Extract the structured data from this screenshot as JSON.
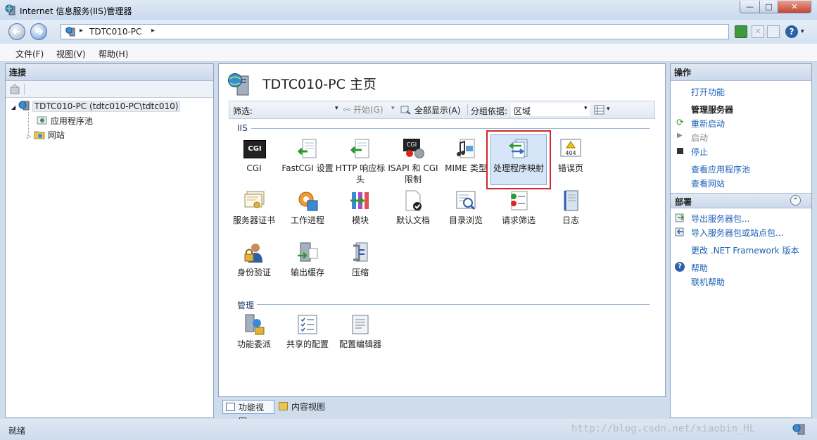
{
  "window": {
    "title": "Internet 信息服务(IIS)管理器",
    "min": "—",
    "max": "□",
    "close": "✕"
  },
  "address": {
    "separator": "▸",
    "host": "TDTC010-PC"
  },
  "toolbar": {
    "stop": "✕",
    "help": "?",
    "help_drop": "▾"
  },
  "menu": [
    "文件(F)",
    "视图(V)",
    "帮助(H)"
  ],
  "connections": {
    "header": "连接",
    "tree": [
      {
        "label": "TDTC010-PC (tdtc010-PC\\tdtc010)",
        "expander": "◢"
      },
      {
        "label": "应用程序池"
      },
      {
        "label": "网站",
        "expander": "▷"
      }
    ]
  },
  "main": {
    "title": "TDTC010-PC 主页",
    "filter": {
      "label": "筛选:",
      "go": "开始(G)",
      "show_all": "全部显示(A)",
      "group_by": "分组依据:",
      "group_value": "区域"
    },
    "sections": [
      {
        "label": "IIS",
        "features": [
          [
            "CGI",
            "FastCGI 设置",
            "HTTP 响应标头",
            "ISAPI 和 CGI 限制",
            "MIME 类型",
            "处理程序映射",
            "错误页"
          ],
          [
            "服务器证书",
            "工作进程",
            "模块",
            "默认文档",
            "目录浏览",
            "请求筛选",
            "日志"
          ],
          [
            "身份验证",
            "输出缓存",
            "压缩"
          ]
        ]
      },
      {
        "label": "管理",
        "features": [
          [
            "功能委派",
            "共享的配置",
            "配置编辑器"
          ]
        ]
      }
    ],
    "selected_feature": "处理程序映射",
    "tabs": [
      "功能视图",
      "内容视图"
    ],
    "active_tab": "功能视图"
  },
  "actions": {
    "header": "操作",
    "open_feature": "打开功能",
    "manage_server": "管理服务器",
    "restart": "重新启动",
    "start": "启动",
    "stop": "停止",
    "view_app_pools": "查看应用程序池",
    "view_sites": "查看网站",
    "deploy_header": "部署",
    "collapse": "⌃",
    "export_pkg": "导出服务器包...",
    "import_pkg": "导入服务器包或站点包...",
    "change_net": "更改 .NET Framework 版本",
    "help": "帮助",
    "online_help": "联机帮助"
  },
  "status": {
    "text": "就绪",
    "watermark": "http://blog.csdn.net/xiaobin_HL"
  },
  "colors": {
    "link": "#1a5fb4",
    "selection": "#d4262a",
    "accent": "#2d5fa8"
  },
  "icons": {
    "row1": [
      "cgi-icon",
      "fastcgi-icon",
      "http-headers-icon",
      "isapi-icon",
      "mime-icon",
      "handler-mappings-icon",
      "error-pages-icon"
    ],
    "row2": [
      "certificates-icon",
      "worker-processes-icon",
      "modules-icon",
      "default-document-icon",
      "directory-browsing-icon",
      "request-filtering-icon",
      "logging-icon"
    ],
    "row3": [
      "authentication-icon",
      "output-caching-icon",
      "compression-icon"
    ],
    "row4": [
      "feature-delegation-icon",
      "shared-config-icon",
      "config-editor-icon"
    ]
  },
  "icon_glyphs": {
    "cgi": "CGI",
    "error": "404",
    "isapi": "CGI"
  }
}
